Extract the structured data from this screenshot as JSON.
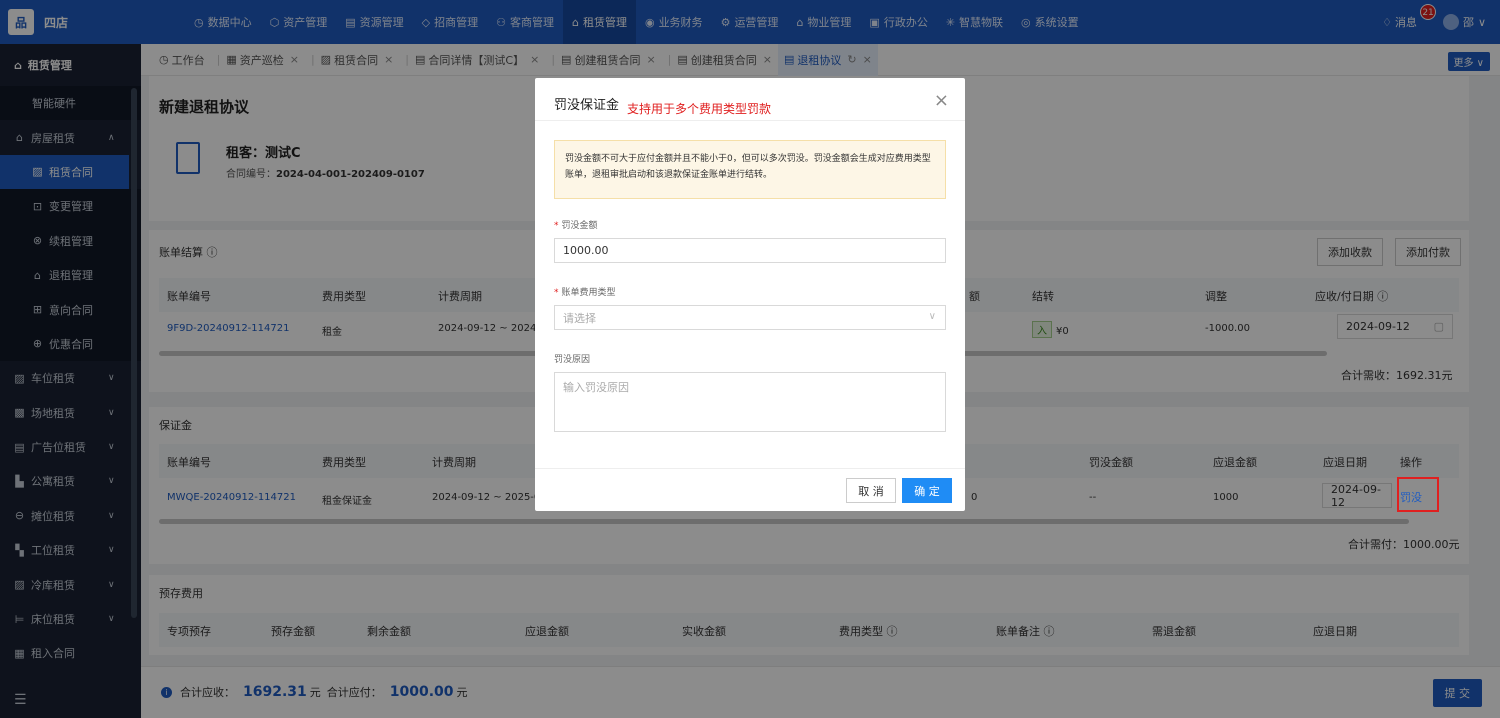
{
  "app": {
    "brand": "四店",
    "logo_text": "品"
  },
  "topnav": [
    {
      "icon": "◷",
      "label": "数据中心"
    },
    {
      "icon": "⬡",
      "label": "资产管理"
    },
    {
      "icon": "▤",
      "label": "资源管理"
    },
    {
      "icon": "◇",
      "label": "招商管理"
    },
    {
      "icon": "⚇",
      "label": "客商管理"
    },
    {
      "icon": "⌂",
      "label": "租赁管理"
    },
    {
      "icon": "◉",
      "label": "业务财务"
    },
    {
      "icon": "⚙",
      "label": "运营管理"
    },
    {
      "icon": "⌂",
      "label": "物业管理"
    },
    {
      "icon": "▣",
      "label": "行政办公"
    },
    {
      "icon": "✳",
      "label": "智慧物联"
    },
    {
      "icon": "◎",
      "label": "系统设置"
    }
  ],
  "topright": {
    "messages_label": "消息",
    "messages_count": "21",
    "user_name": "邵"
  },
  "sidebar": {
    "header": "租赁管理",
    "items": [
      {
        "label": "智能硬件",
        "icon": ""
      },
      {
        "label": "房屋租赁",
        "icon": "⌂"
      },
      {
        "label": "租赁合同",
        "icon": "▨"
      },
      {
        "label": "变更管理",
        "icon": "⊡"
      },
      {
        "label": "续租管理",
        "icon": "⊗"
      },
      {
        "label": "退租管理",
        "icon": "⌂"
      },
      {
        "label": "意向合同",
        "icon": "⊞"
      },
      {
        "label": "优惠合同",
        "icon": "⊕"
      },
      {
        "label": "车位租赁",
        "icon": "▨"
      },
      {
        "label": "场地租赁",
        "icon": "▩"
      },
      {
        "label": "广告位租赁",
        "icon": "▤"
      },
      {
        "label": "公寓租赁",
        "icon": "▙"
      },
      {
        "label": "摊位租赁",
        "icon": "⊖"
      },
      {
        "label": "工位租赁",
        "icon": "▚"
      },
      {
        "label": "冷库租赁",
        "icon": "▨"
      },
      {
        "label": "床位租赁",
        "icon": "⊨"
      },
      {
        "label": "租入合同",
        "icon": "▦"
      }
    ],
    "collapse_icon": "☰"
  },
  "tabs": [
    {
      "icon": "◷",
      "label": "工作台"
    },
    {
      "icon": "▦",
      "label": "资产巡检"
    },
    {
      "icon": "▨",
      "label": "租赁合同"
    },
    {
      "icon": "▤",
      "label": "合同详情【测试C】"
    },
    {
      "icon": "▤",
      "label": "创建租赁合同"
    },
    {
      "icon": "▤",
      "label": "创建租赁合同"
    },
    {
      "icon": "▤",
      "label": "退租协议"
    }
  ],
  "tabs_more": "更多 ∨",
  "page": {
    "title": "新建退租协议",
    "tenant": "租客：测试C",
    "contract_no_label": "合同编号：",
    "contract_no": "2024-04-001-202409-0107"
  },
  "billing": {
    "title": "账单结算 ⓘ",
    "add_receipt": "添加收款",
    "add_payment": "添加付款",
    "headers": [
      "账单编号",
      "费用类型",
      "计费周期",
      "额",
      "结转",
      "调整",
      "应收/付日期 ⓘ"
    ],
    "row": {
      "bill_no": "9F9D-20240912-114721",
      "fee_type": "租金",
      "period": "2024-09-12 ~ 2024-1",
      "carry_tag": "入",
      "carry_amount": "¥0",
      "adjust": "-1000.00",
      "date": "2024-09-12"
    },
    "total": "合计需收：1692.31元"
  },
  "deposit": {
    "title": "保证金",
    "headers": [
      "账单编号",
      "费用类型",
      "计费周期",
      "罚没金额",
      "应退金额",
      "应退日期",
      "操作"
    ],
    "row": {
      "bill_no": "MWQE-20240912-114721",
      "fee_type": "租金保证金",
      "period": "2024-09-12 ~ 2025-09-1",
      "carry": "0",
      "penalty": "--",
      "refund": "1000",
      "date": "2024-09-12",
      "action": "罚没"
    },
    "total": "合计需付：1000.00元"
  },
  "prestore": {
    "title": "预存费用",
    "headers": [
      "专项预存",
      "预存金额",
      "剩余金额",
      "应退金额",
      "实收金额",
      "费用类型 ⓘ",
      "账单备注 ⓘ",
      "需退金额",
      "应退日期"
    ]
  },
  "footer": {
    "receivable_label": "合计应收：",
    "receivable": "1692.31",
    "unit1": "元",
    "payable_label": "合计应付：",
    "payable": "1000.00",
    "unit2": "元",
    "submit": "提 交"
  },
  "modal": {
    "title": "罚没保证金",
    "note": "支持用于多个费用类型罚款",
    "alert": "罚没金额不可大于应付金额并且不能小于0，但可以多次罚没。罚没金额会生成对应费用类型账单，退租审批启动和该退款保证金账单进行结转。",
    "amount_label": "罚没金额",
    "amount_value": "1000.00",
    "fee_type_label": "账单费用类型",
    "fee_type_placeholder": "请选择",
    "reason_label": "罚没原因",
    "reason_placeholder": "输入罚没原因",
    "cancel": "取 消",
    "confirm": "确 定"
  }
}
